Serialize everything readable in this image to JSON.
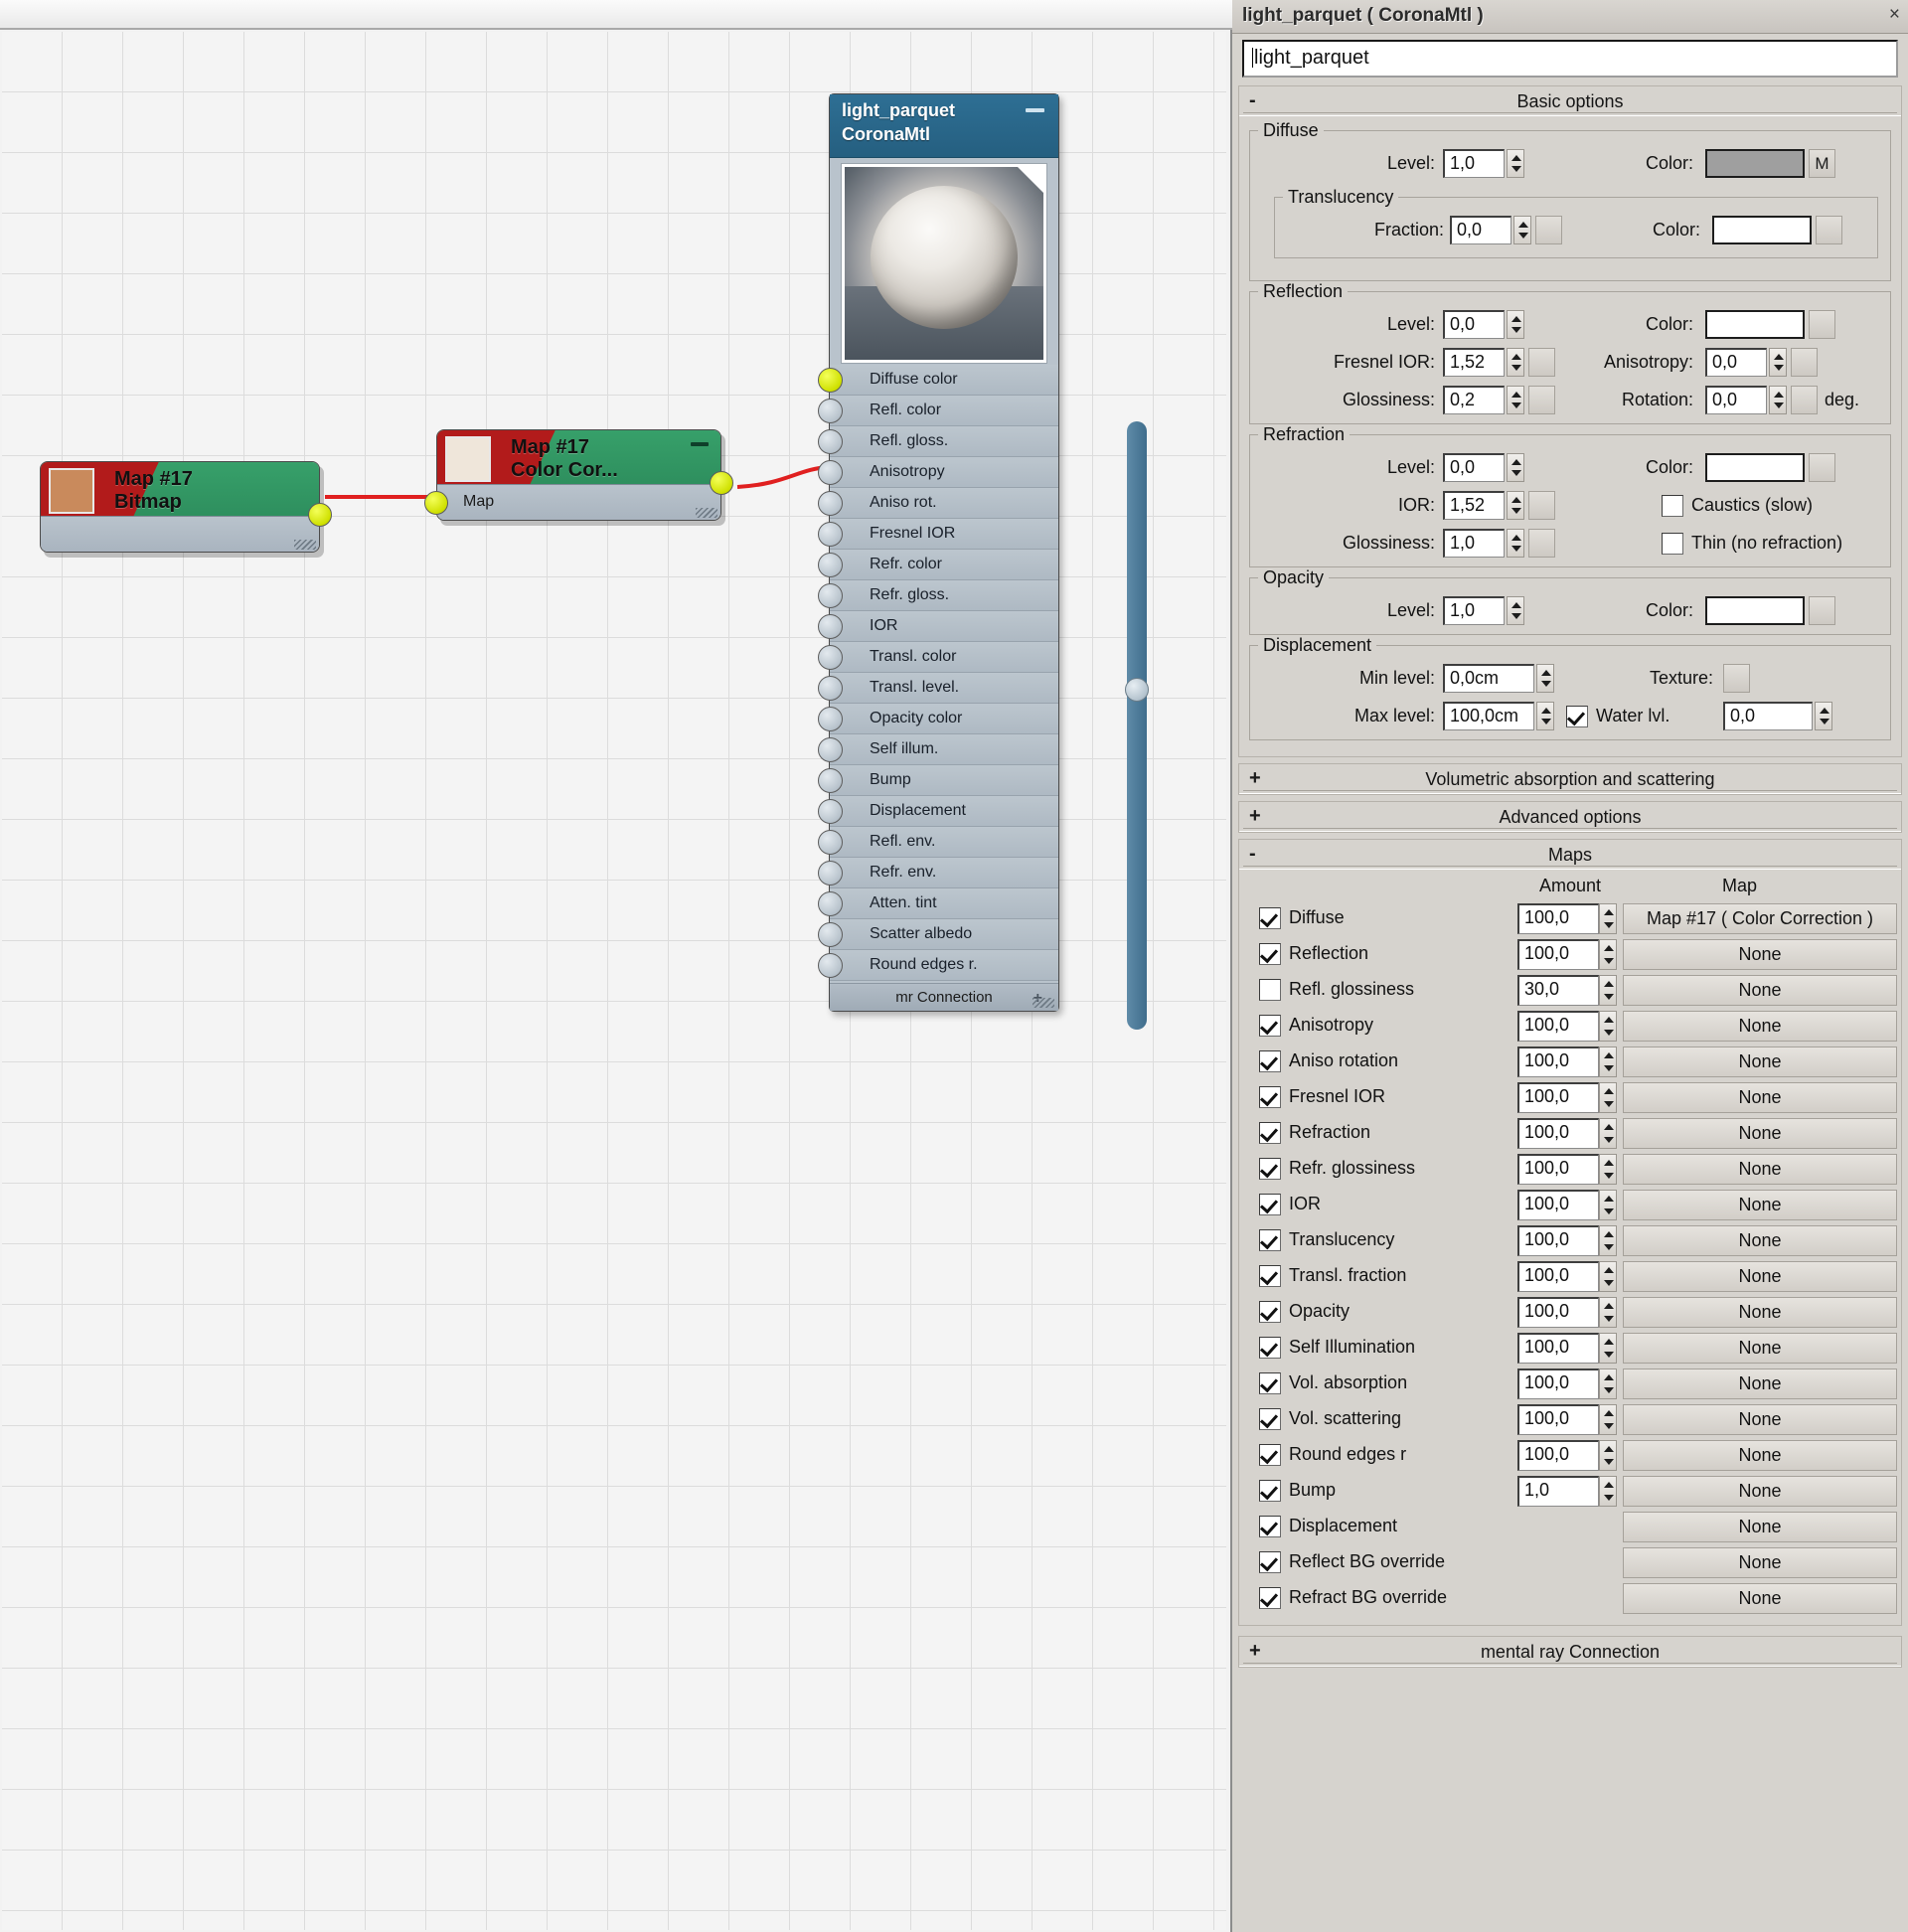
{
  "window": {
    "title": "light_parquet  ( CoronaMtl )",
    "close_label": "×",
    "material_name": "light_parquet"
  },
  "graph": {
    "nodes": [
      {
        "id": "bitmap-node",
        "title_line1": "Map #17",
        "title_line2": "Bitmap",
        "thumb_color": "#c98a5c",
        "output_socket": "yellow"
      },
      {
        "id": "colorcorrection-node",
        "title_line1": "Map #17",
        "title_line2": "Color Cor...",
        "thumb_color": "#efe6da",
        "input_label": "Map",
        "output_socket": "yellow"
      }
    ],
    "material_node": {
      "title_line1": "light_parquet",
      "title_line2": "CoronaMtl",
      "footer_label": "mr Connection",
      "footer_plus": "+",
      "slots": [
        {
          "label": "Diffuse color",
          "connected": true
        },
        {
          "label": "Refl. color",
          "connected": false
        },
        {
          "label": "Refl. gloss.",
          "connected": false
        },
        {
          "label": "Anisotropy",
          "connected": false
        },
        {
          "label": "Aniso rot.",
          "connected": false
        },
        {
          "label": "Fresnel IOR",
          "connected": false
        },
        {
          "label": "Refr. color",
          "connected": false
        },
        {
          "label": "Refr. gloss.",
          "connected": false
        },
        {
          "label": "IOR",
          "connected": false
        },
        {
          "label": "Transl. color",
          "connected": false
        },
        {
          "label": "Transl. level.",
          "connected": false
        },
        {
          "label": "Opacity color",
          "connected": false
        },
        {
          "label": "Self illum.",
          "connected": false
        },
        {
          "label": "Bump",
          "connected": false
        },
        {
          "label": "Displacement",
          "connected": false
        },
        {
          "label": "Refl. env.",
          "connected": false
        },
        {
          "label": "Refr. env.",
          "connected": false
        },
        {
          "label": "Atten. tint",
          "connected": false
        },
        {
          "label": "Scatter albedo",
          "connected": false
        },
        {
          "label": "Round edges r.",
          "connected": false
        }
      ]
    },
    "wire_color": "#e02020"
  },
  "basic_options": {
    "rollout_label": "Basic options",
    "rollout_state": "-",
    "diffuse": {
      "group_title": "Diffuse",
      "level_label": "Level:",
      "level_value": "1,0",
      "color_label": "Color:",
      "color_value": "#9f9f9f",
      "map_button_label": "M",
      "translucency": {
        "group_title": "Translucency",
        "fraction_label": "Fraction:",
        "fraction_value": "0,0",
        "color_label": "Color:",
        "color_value": "#ffffff"
      }
    },
    "reflection": {
      "group_title": "Reflection",
      "level_label": "Level:",
      "level_value": "0,0",
      "color_label": "Color:",
      "color_value": "#ffffff",
      "fresnel_label": "Fresnel IOR:",
      "fresnel_value": "1,52",
      "anisotropy_label": "Anisotropy:",
      "anisotropy_value": "0,0",
      "glossiness_label": "Glossiness:",
      "glossiness_value": "0,2",
      "rotation_label": "Rotation:",
      "rotation_value": "0,0",
      "rotation_unit": "deg."
    },
    "refraction": {
      "group_title": "Refraction",
      "level_label": "Level:",
      "level_value": "0,0",
      "color_label": "Color:",
      "color_value": "#ffffff",
      "ior_label": "IOR:",
      "ior_value": "1,52",
      "caustics_label": "Caustics (slow)",
      "caustics_checked": false,
      "glossiness_label": "Glossiness:",
      "glossiness_value": "1,0",
      "thin_label": "Thin (no refraction)",
      "thin_checked": false
    },
    "opacity": {
      "group_title": "Opacity",
      "level_label": "Level:",
      "level_value": "1,0",
      "color_label": "Color:",
      "color_value": "#ffffff"
    },
    "displacement": {
      "group_title": "Displacement",
      "min_label": "Min level:",
      "min_value": "0,0cm",
      "texture_label": "Texture:",
      "max_label": "Max level:",
      "max_value": "100,0cm",
      "water_label": "Water lvl.",
      "water_checked": true,
      "water_value": "0,0"
    }
  },
  "rollouts": [
    {
      "state": "+",
      "label": "Volumetric absorption and scattering"
    },
    {
      "state": "+",
      "label": "Advanced options"
    }
  ],
  "maps": {
    "rollout_label": "Maps",
    "rollout_state": "-",
    "col_amount": "Amount",
    "col_map": "Map",
    "rows": [
      {
        "checked": true,
        "name": "Diffuse",
        "amount": "100,0",
        "map": "Map #17  ( Color Correction )"
      },
      {
        "checked": true,
        "name": "Reflection",
        "amount": "100,0",
        "map": "None"
      },
      {
        "checked": false,
        "name": "Refl. glossiness",
        "amount": "30,0",
        "map": "None"
      },
      {
        "checked": true,
        "name": "Anisotropy",
        "amount": "100,0",
        "map": "None"
      },
      {
        "checked": true,
        "name": "Aniso rotation",
        "amount": "100,0",
        "map": "None"
      },
      {
        "checked": true,
        "name": "Fresnel IOR",
        "amount": "100,0",
        "map": "None"
      },
      {
        "checked": true,
        "name": "Refraction",
        "amount": "100,0",
        "map": "None"
      },
      {
        "checked": true,
        "name": "Refr. glossiness",
        "amount": "100,0",
        "map": "None"
      },
      {
        "checked": true,
        "name": "IOR",
        "amount": "100,0",
        "map": "None"
      },
      {
        "checked": true,
        "name": "Translucency",
        "amount": "100,0",
        "map": "None"
      },
      {
        "checked": true,
        "name": "Transl. fraction",
        "amount": "100,0",
        "map": "None"
      },
      {
        "checked": true,
        "name": "Opacity",
        "amount": "100,0",
        "map": "None"
      },
      {
        "checked": true,
        "name": "Self Illumination",
        "amount": "100,0",
        "map": "None"
      },
      {
        "checked": true,
        "name": "Vol. absorption",
        "amount": "100,0",
        "map": "None"
      },
      {
        "checked": true,
        "name": "Vol. scattering",
        "amount": "100,0",
        "map": "None"
      },
      {
        "checked": true,
        "name": "Round edges r",
        "amount": "100,0",
        "map": "None"
      },
      {
        "checked": true,
        "name": "Bump",
        "amount": "1,0",
        "map": "None"
      },
      {
        "checked": true,
        "name": "Displacement",
        "amount": "",
        "map": "None"
      },
      {
        "checked": true,
        "name": "Reflect BG override",
        "amount": "",
        "map": "None"
      },
      {
        "checked": true,
        "name": "Refract BG override",
        "amount": "",
        "map": "None"
      }
    ]
  },
  "bottom_rollout": {
    "state": "+",
    "label": "mental ray Connection"
  }
}
